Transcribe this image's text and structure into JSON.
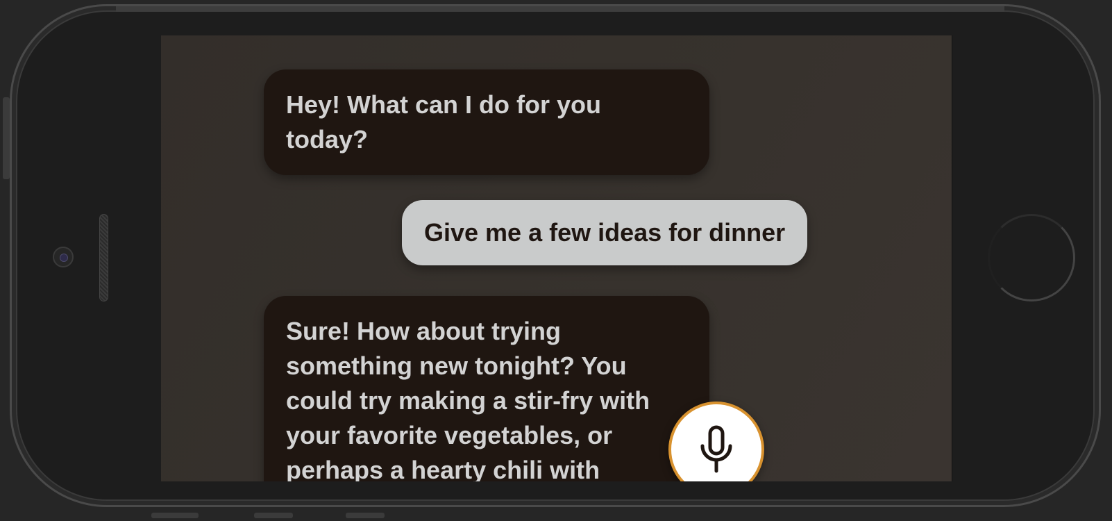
{
  "conversation": {
    "messages": [
      {
        "role": "assistant",
        "text": "Hey! What can I do for you today?"
      },
      {
        "role": "user",
        "text": "Give me a few ideas for dinner"
      },
      {
        "role": "assistant",
        "text": "Sure! How about trying something new tonight? You could try making a stir-fry with your favorite vegetables, or perhaps a hearty chili with"
      }
    ]
  },
  "mic": {
    "icon": "microphone-icon"
  },
  "colors": {
    "assistant_bubble": "#1f1611",
    "user_bubble": "#c9cbcb",
    "mic_ring": "#d8922f",
    "screen_bg": "#35302c"
  }
}
